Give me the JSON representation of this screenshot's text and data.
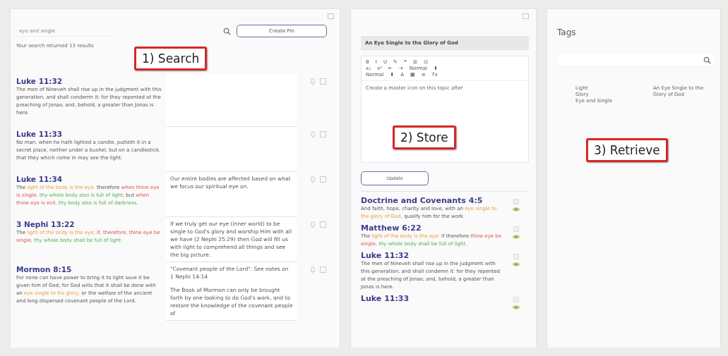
{
  "search": {
    "value": "eye and single",
    "button": "Create Pin",
    "results_text": "Your search returned 13 results"
  },
  "results": [
    {
      "reference": "Luke 11:32",
      "segments": [
        {
          "text": "The men of Nineveh shall rise up in the judgment with this generation, and shall condemn it: for they repented at the preaching of Jonas; and, behold, a greater than Jonas is here.",
          "kind": "plain"
        }
      ]
    },
    {
      "reference": "Luke 11:33",
      "segments": [
        {
          "text": "No man, when he hath lighted a candle, putteth it in a secret place, neither under a bushel, but on a candlestick, that they which come in may see the light.",
          "kind": "plain"
        }
      ]
    },
    {
      "reference": "Luke 11:34",
      "segments": [
        {
          "text": "The ",
          "kind": "plain"
        },
        {
          "text": "light of the body is the eye:",
          "kind": "subject"
        },
        {
          "text": " therefore ",
          "kind": "plain"
        },
        {
          "text": "when thine eye is single,",
          "kind": "condition"
        },
        {
          "text": " thy whole body also is full of light;",
          "kind": "result"
        },
        {
          "text": " but ",
          "kind": "plain"
        },
        {
          "text": "when thine eye is evil,",
          "kind": "condition"
        },
        {
          "text": " thy body also is full of darkness.",
          "kind": "result"
        }
      ],
      "note": [
        "Our entire bodies are affected based on what we focus our spiritual eye on."
      ]
    },
    {
      "reference": "3 Nephi 13:22",
      "segments": [
        {
          "text": "The ",
          "kind": "plain"
        },
        {
          "text": "light of the body is the eye;",
          "kind": "subject"
        },
        {
          "text": " if, therefore, thine eye be single,",
          "kind": "condition"
        },
        {
          "text": " thy whole body shall be full of light.",
          "kind": "result"
        }
      ],
      "note": [
        "If we truly get our eye (inner world) to be single to God's glory and worship Him with all we have (2 Nephi 25:29) then God will fill us with light to comprehend all things and see the big picture."
      ]
    },
    {
      "reference": "Mormon 8:15",
      "segments": [
        {
          "text": "For none can have power to bring it to light save it be given him of God; for God wills that it shall be done with an ",
          "kind": "plain"
        },
        {
          "text": "eye single to his glory,",
          "kind": "subject"
        },
        {
          "text": " or the welfare of the ancient and long dispersed covenant people of the Lord.",
          "kind": "plain"
        }
      ],
      "note": [
        "\"Covenant people of the Lord\": See notes on 1 Nephi 14:14",
        "The Book of Mormon can only be brought forth by one looking to do God's work, and to restore the knowledge of the covenant people of"
      ]
    }
  ],
  "pin": {
    "title": "An Eye Single to the Glory of God",
    "toolbar": [
      [
        "B",
        "I",
        "U",
        "✎",
        "❝",
        "☰",
        "☷"
      ],
      [
        "x₂",
        "x²",
        "⇤",
        "⇥",
        "Normal",
        "⬍"
      ],
      [
        "Normal",
        "⬍",
        "A",
        "▦",
        "≡",
        "Tx"
      ]
    ],
    "body": "Create a master icon on this topic after",
    "button": "Update"
  },
  "pinned": [
    {
      "reference": "Doctrine and Covenants 4:5",
      "segments": [
        {
          "text": "And faith, hope, charity and love, with an ",
          "kind": "plain"
        },
        {
          "text": "eye single to the glory of God,",
          "kind": "subject"
        },
        {
          "text": " qualify him for the work.",
          "kind": "plain"
        }
      ]
    },
    {
      "reference": "Matthew 6:22",
      "segments": [
        {
          "text": "The ",
          "kind": "plain"
        },
        {
          "text": "light of the body is the eye:",
          "kind": "subject"
        },
        {
          "text": " if therefore ",
          "kind": "plain"
        },
        {
          "text": "thine eye be single,",
          "kind": "condition"
        },
        {
          "text": " thy whole body shall be full of light.",
          "kind": "result"
        }
      ]
    },
    {
      "reference": "Luke 11:32",
      "segments": [
        {
          "text": "The men of Nineveh shall rise up in the judgment with this generation, and shall condemn it: for they repented at the preaching of Jonas; and, behold, a greater than Jonas is here.",
          "kind": "plain"
        }
      ]
    },
    {
      "reference": "Luke 11:33"
    }
  ],
  "tags": {
    "title": "Tags",
    "tags": [
      "Light",
      "Glory",
      "Eye and Single"
    ],
    "pins": [
      "An Eye Single to the",
      "Glory of God"
    ]
  },
  "callouts": [
    "1) Search",
    "2) Store",
    "3) Retrieve"
  ]
}
